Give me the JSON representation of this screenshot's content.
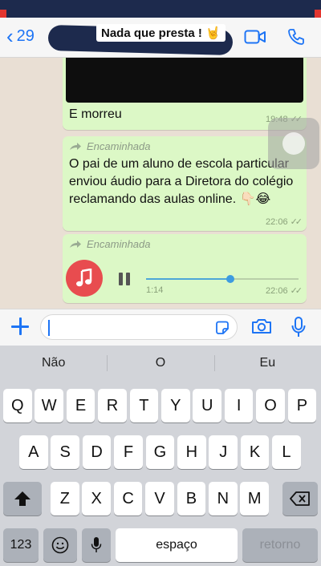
{
  "header": {
    "back_count": "29",
    "contact_name": "Nada que presta ! 🤘"
  },
  "messages": [
    {
      "text": "E morreu",
      "time": "19:48"
    },
    {
      "forwarded_label": "Encaminhada",
      "text": "O pai de um aluno de escola particular enviou áudio para a Diretora do colégio reclamando das aulas online. 👇🏻😂",
      "time": "22:06"
    },
    {
      "forwarded_label": "Encaminhada",
      "audio_duration": "1:14",
      "time": "22:06",
      "audio_progress": 0.55
    }
  ],
  "input": {
    "placeholder": ""
  },
  "keyboard": {
    "suggestions": [
      "Não",
      "O",
      "Eu"
    ],
    "row1": [
      "Q",
      "W",
      "E",
      "R",
      "T",
      "Y",
      "U",
      "I",
      "O",
      "P"
    ],
    "row2": [
      "A",
      "S",
      "D",
      "F",
      "G",
      "H",
      "J",
      "K",
      "L"
    ],
    "row3": [
      "Z",
      "X",
      "C",
      "V",
      "B",
      "N",
      "M"
    ],
    "numbers_key": "123",
    "space_key": "espaço",
    "return_key": "retorno"
  },
  "colors": {
    "accent": "#1d74f5",
    "bubble": "#dcf8c6",
    "audio_avatar": "#e84c4f"
  }
}
